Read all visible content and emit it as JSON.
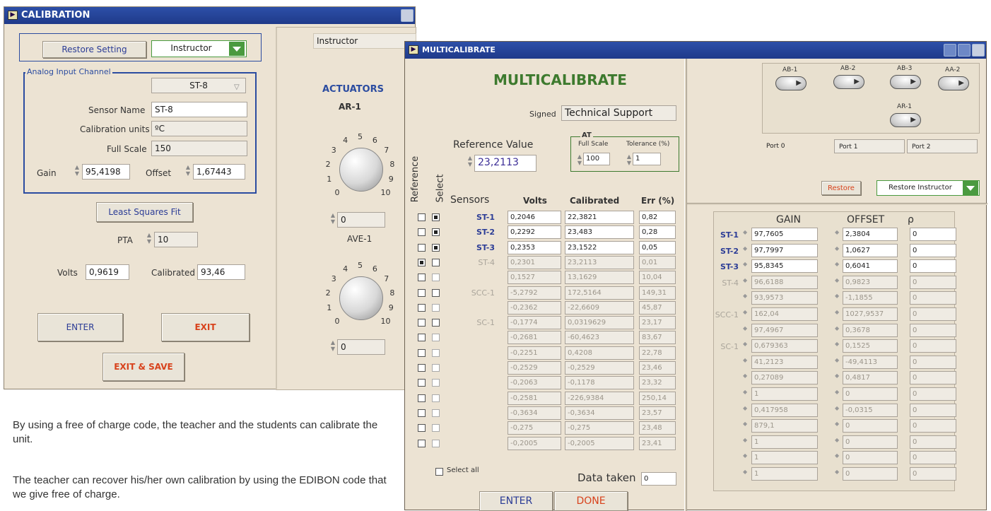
{
  "calibration": {
    "title": "CALIBRATION",
    "restore_label": "Restore Setting",
    "user_select": "Instructor",
    "user_display": "Instructor",
    "group_label": "Analog Input Channel",
    "channel_select": "ST-8",
    "sensor_name_label": "Sensor Name",
    "sensor_name": "ST-8",
    "units_label": "Calibration units",
    "units": "ºC",
    "full_scale_label": "Full Scale",
    "full_scale": "150",
    "gain_label": "Gain",
    "gain": "95,4198",
    "offset_label": "Offset",
    "offset": "1,67443",
    "lsf_label": "Least Squares Fit",
    "pta_label": "PTA",
    "pta": "10",
    "volts_label": "Volts",
    "volts": "0,9619",
    "calibrated_label": "Calibrated",
    "calibrated": "93,46",
    "enter_label": "ENTER",
    "exit_label": "EXIT",
    "exit_save_label": "EXIT & SAVE",
    "actuators_title": "ACTUATORS",
    "knob1_label": "AR-1",
    "knob1_value": "0",
    "knob2_label": "AVE-1",
    "knob2_value": "0",
    "knob_scale": [
      "0",
      "1",
      "2",
      "3",
      "4",
      "5",
      "6",
      "7",
      "8",
      "9",
      "10"
    ]
  },
  "multi": {
    "title": "MULTICALIBRATE",
    "heading": "MULTICALIBRATE",
    "signed_label": "Signed",
    "signed_value": "Technical Support",
    "ref_value_label": "Reference Value",
    "ref_value": "23,2113",
    "at_label": "AT",
    "full_scale_label": "Full Scale",
    "full_scale": "100",
    "tolerance_label": "Tolerance (%)",
    "tolerance": "1",
    "reference_label": "Reference",
    "select_label": "Select",
    "col_sensors": "Sensors",
    "col_volts": "Volts",
    "col_calibrated": "Calibrated",
    "col_err": "Err (%)",
    "rows": [
      {
        "name": "ST-1",
        "volts": "0,2046",
        "cal": "22,3821",
        "err": "0,82",
        "ref": false,
        "sel": true,
        "active": true
      },
      {
        "name": "ST-2",
        "volts": "0,2292",
        "cal": "23,483",
        "err": "0,28",
        "ref": false,
        "sel": true,
        "active": true
      },
      {
        "name": "ST-3",
        "volts": "0,2353",
        "cal": "23,1522",
        "err": "0,05",
        "ref": false,
        "sel": true,
        "active": true
      },
      {
        "name": "ST-4",
        "volts": "0,2301",
        "cal": "23,2113",
        "err": "0,01",
        "ref": true,
        "sel": false,
        "active": false
      },
      {
        "name": "",
        "volts": "0,1527",
        "cal": "13,1629",
        "err": "10,04",
        "ref": false,
        "sel": false,
        "active": false
      },
      {
        "name": "SCC-1",
        "volts": "-5,2792",
        "cal": "172,5164",
        "err": "149,31",
        "ref": false,
        "sel": false,
        "active": false
      },
      {
        "name": "",
        "volts": "-0,2362",
        "cal": "-22,6609",
        "err": "45,87",
        "ref": false,
        "sel": false,
        "active": false
      },
      {
        "name": "SC-1",
        "volts": "-0,1774",
        "cal": "0,0319629",
        "err": "23,17",
        "ref": false,
        "sel": false,
        "active": false
      },
      {
        "name": "",
        "volts": "-0,2681",
        "cal": "-60,4623",
        "err": "83,67",
        "ref": false,
        "sel": false,
        "active": false
      },
      {
        "name": "",
        "volts": "-0,2251",
        "cal": "0,4208",
        "err": "22,78",
        "ref": false,
        "sel": false,
        "active": false
      },
      {
        "name": "",
        "volts": "-0,2529",
        "cal": "-0,2529",
        "err": "23,46",
        "ref": false,
        "sel": false,
        "active": false
      },
      {
        "name": "",
        "volts": "-0,2063",
        "cal": "-0,1178",
        "err": "23,32",
        "ref": false,
        "sel": false,
        "active": false
      },
      {
        "name": "",
        "volts": "-0,2581",
        "cal": "-226,9384",
        "err": "250,14",
        "ref": false,
        "sel": false,
        "active": false
      },
      {
        "name": "",
        "volts": "-0,3634",
        "cal": "-0,3634",
        "err": "23,57",
        "ref": false,
        "sel": false,
        "active": false
      },
      {
        "name": "",
        "volts": "-0,275",
        "cal": "-0,275",
        "err": "23,48",
        "ref": false,
        "sel": false,
        "active": false
      },
      {
        "name": "",
        "volts": "-0,2005",
        "cal": "-0,2005",
        "err": "23,41",
        "ref": false,
        "sel": false,
        "active": false
      }
    ],
    "select_all_label": "Select all",
    "data_taken_label": "Data taken",
    "data_taken": "0",
    "enter_label": "ENTER",
    "done_label": "DONE",
    "toggles": [
      "AB-1",
      "AB-2",
      "AB-3",
      "AA-2",
      "AR-1"
    ],
    "ports": [
      "Port 0",
      "Port 1",
      "Port 2"
    ],
    "restore_label": "Restore",
    "restore_select": "Restore Instructor",
    "col_gain": "GAIN",
    "col_offset": "OFFSET",
    "col_rho": "ρ",
    "cal_rows": [
      {
        "name": "ST-1",
        "gain": "97,7605",
        "offset": "2,3804",
        "rho": "0",
        "active": true
      },
      {
        "name": "ST-2",
        "gain": "97,7997",
        "offset": "1,0627",
        "rho": "0",
        "active": true
      },
      {
        "name": "ST-3",
        "gain": "95,8345",
        "offset": "0,6041",
        "rho": "0",
        "active": true
      },
      {
        "name": "ST-4",
        "gain": "96,6188",
        "offset": "0,9823",
        "rho": "0",
        "active": false
      },
      {
        "name": "",
        "gain": "93,9573",
        "offset": "-1,1855",
        "rho": "0",
        "active": false
      },
      {
        "name": "SCC-1",
        "gain": "162,04",
        "offset": "1027,9537",
        "rho": "0",
        "active": false
      },
      {
        "name": "",
        "gain": "97,4967",
        "offset": "0,3678",
        "rho": "0",
        "active": false
      },
      {
        "name": "SC-1",
        "gain": "0,679363",
        "offset": "0,1525",
        "rho": "0",
        "active": false
      },
      {
        "name": "",
        "gain": "41,2123",
        "offset": "-49,4113",
        "rho": "0",
        "active": false
      },
      {
        "name": "",
        "gain": "0,27089",
        "offset": "0,4817",
        "rho": "0",
        "active": false
      },
      {
        "name": "",
        "gain": "1",
        "offset": "0",
        "rho": "0",
        "active": false
      },
      {
        "name": "",
        "gain": "0,417958",
        "offset": "-0,0315",
        "rho": "0",
        "active": false
      },
      {
        "name": "",
        "gain": "879,1",
        "offset": "0",
        "rho": "0",
        "active": false
      },
      {
        "name": "",
        "gain": "1",
        "offset": "0",
        "rho": "0",
        "active": false
      },
      {
        "name": "",
        "gain": "1",
        "offset": "0",
        "rho": "0",
        "active": false
      },
      {
        "name": "",
        "gain": "1",
        "offset": "0",
        "rho": "0",
        "active": false
      }
    ]
  },
  "caption": {
    "p1": "By using a free of charge code, the teacher and the students can calibrate the unit.",
    "p2": "The teacher can recover his/her own calibration by using the EDIBON code that we give free of charge."
  }
}
